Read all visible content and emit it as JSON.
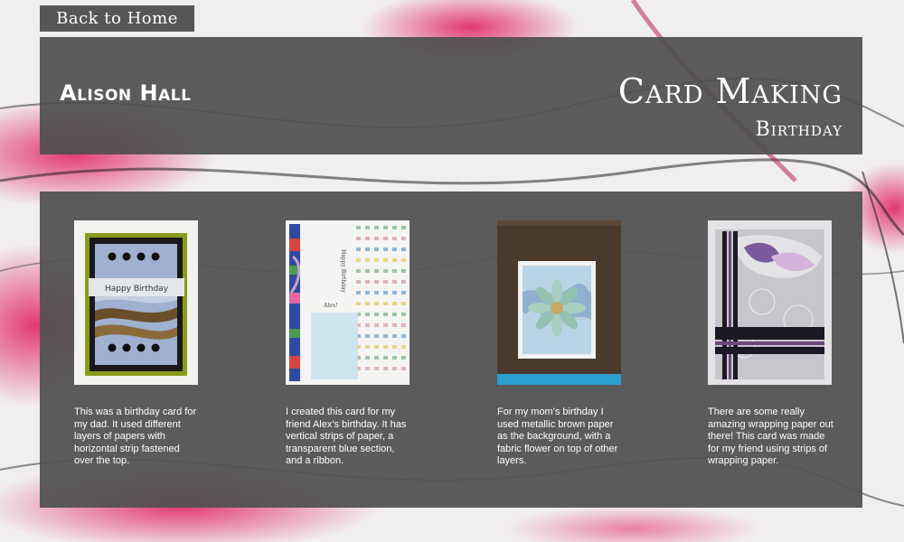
{
  "nav": {
    "back_label": "Back to Home"
  },
  "header": {
    "author": "Alison Hall",
    "title": "Card Making",
    "subtitle": "Birthday"
  },
  "cards": [
    {
      "caption": "This was a birthday card for my dad. It used different layers of papers with horizontal strip fastened over the top.",
      "inner_text": "Happy Birthday"
    },
    {
      "caption": "I created this card for my friend Alex's birthday. It has vertical strips of paper, a transparent blue section, and a ribbon.",
      "inner_text": "Happy Birthday",
      "inner_text2": "Alex!"
    },
    {
      "caption": "For my mom's birthday I used metallic brown paper as the background, with a fabric flower on top of other layers."
    },
    {
      "caption": "There are some really amazing wrapping paper out there! This card was made for my friend using strips of wrapping paper."
    }
  ],
  "colors": {
    "panel": "#4e4e4e",
    "accent": "#d0104a",
    "text": "#ffffff"
  }
}
